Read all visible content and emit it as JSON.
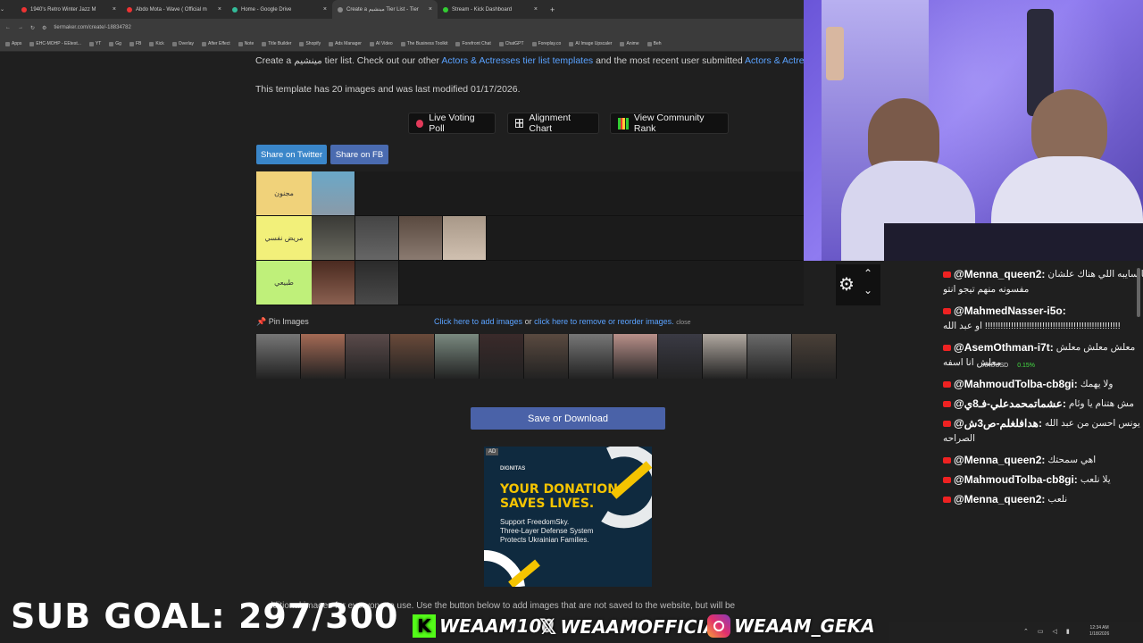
{
  "browser": {
    "tabs": [
      {
        "label": "1940's Retro Winter Jazz M",
        "color": "#e33"
      },
      {
        "label": "Abdo Mota - Wave ( Official m",
        "color": "#e33"
      },
      {
        "label": "Home - Google Drive",
        "color": "#3b9"
      },
      {
        "label": "Create a مينشيم Tier List - Tier",
        "color": "#888"
      },
      {
        "label": "Stream - Kick Dashboard",
        "color": "#3c3"
      }
    ],
    "url": "tiermaker.com/create/-18834782",
    "bookmarks": [
      "Apps",
      "EHC-MOHP - EEtest...",
      "YT",
      "Gg",
      "FB",
      "Kick",
      "Overlay",
      "After Effect",
      "Note",
      "Title Builder",
      "Shopify",
      "Ads Manager",
      "AI Video",
      "The Business Toolkit",
      "Forefront Chat",
      "ChatGPT",
      "Foreplay.co",
      "AI Image Upscaler",
      "Anime",
      "Beh"
    ]
  },
  "page": {
    "intro_prefix": "Create a مينشيم tier list. Check out our other",
    "intro_link1": "Actors & Actresses tier list templates",
    "intro_mid": "and the most recent user submitted",
    "intro_link2": "Actors & Actre",
    "template_info": "This template has 20 images and was last modified 01/17/2026.",
    "buttons": {
      "live_voting": "Live Voting Poll",
      "alignment": "Alignment Chart",
      "community_rank": "View Community Rank"
    },
    "share": {
      "twitter": "Share on Twitter",
      "fb": "Share on FB"
    },
    "tiers": [
      {
        "label": "مجنون",
        "color": "#f0d27a",
        "images": [
          "#8a9aa8"
        ]
      },
      {
        "label": "مريض نفسي",
        "color": "#f2f07a",
        "images": [
          "#4a4a46",
          "#555",
          "#6a5a50",
          "#b9a89a"
        ]
      },
      {
        "label": "طبيعي",
        "color": "#bff07a",
        "images": [
          "#5a3a30",
          "#3a3a3a"
        ]
      }
    ],
    "pin_images": "Pin Images",
    "add_images_link": "Click here to add images",
    "or": "or",
    "remove_link": "click here to remove or reorder images.",
    "close": "close",
    "pool_images": [
      "#777",
      "#a46a55",
      "#5a4a4a",
      "#6a4a3a",
      "#7a8a80",
      "#3a2a2a",
      "#5a4a40",
      "#777",
      "#b9908a",
      "#3a3a44",
      "#b0a8a0",
      "#6a6a6a",
      "#4a4038"
    ],
    "save_download": "Save or Download",
    "ad": {
      "tag": "AD",
      "brand": "DIGNITAS",
      "headline1": "YOUR DONATION",
      "headline2": "SAVES LIVES.",
      "body1": "Support FreedomSky.",
      "body2": "Three-Layer Defense System",
      "body3": "Protects Ukrainian Families."
    },
    "footer_text": "dditional images for everyone to use. Use the button below to add images that are not saved to the website, but will be"
  },
  "chat": [
    {
      "user": "@Menna_queen2:",
      "text": "انا سايبه اللي هناك علشان",
      "line2": "مفسونه منهم تيجو انتو"
    },
    {
      "user": "@MahmedNasser-i5o:",
      "text": "",
      "line2": "او عبد الله !!!!!!!!!!!!!!!!!!!!!!!!!!!!!!!!!!!!!!!!!!!!!!!!!!!!"
    },
    {
      "user": "@AsemOthman-i7t:",
      "text": "معلش معلش معلش",
      "line2": "معلش انا اسفه"
    },
    {
      "user": "@MahmoudTolba-cb8gi:",
      "text": "ولا يهمك",
      "line2": ""
    },
    {
      "user": "@عشماتمحمدعلي-فـ8ي:",
      "text": "مش هتنام يا وئام",
      "line2": ""
    },
    {
      "user": "@هدافلغلم-ص3ش:",
      "text": "بس يونس احسن من عبد الله",
      "line2": "الصراحه"
    },
    {
      "user": "@Menna_queen2:",
      "text": "اهي سمحتك",
      "line2": ""
    },
    {
      "user": "@MahmoudTolba-cb8gi:",
      "text": "يلا نلعب",
      "line2": ""
    },
    {
      "user": "@Menna_queen2:",
      "text": "نلعب",
      "line2": ""
    }
  ],
  "ticker": {
    "symbol": "XAUUSD",
    "change": "0.15%"
  },
  "overlay": {
    "sub_goal": "SUB GOAL: 297/300",
    "kick": "WEAAM100",
    "x": "WEAAMOFFICIAL",
    "instagram": "WEAAM_GEKA"
  },
  "clock": {
    "time": "12:34 AM",
    "date": "1/18/2026"
  },
  "colors": {
    "accent": "#5aa2ff",
    "save": "#4a62a8",
    "share": "#3a86c9",
    "cam": "#7a66e6"
  }
}
